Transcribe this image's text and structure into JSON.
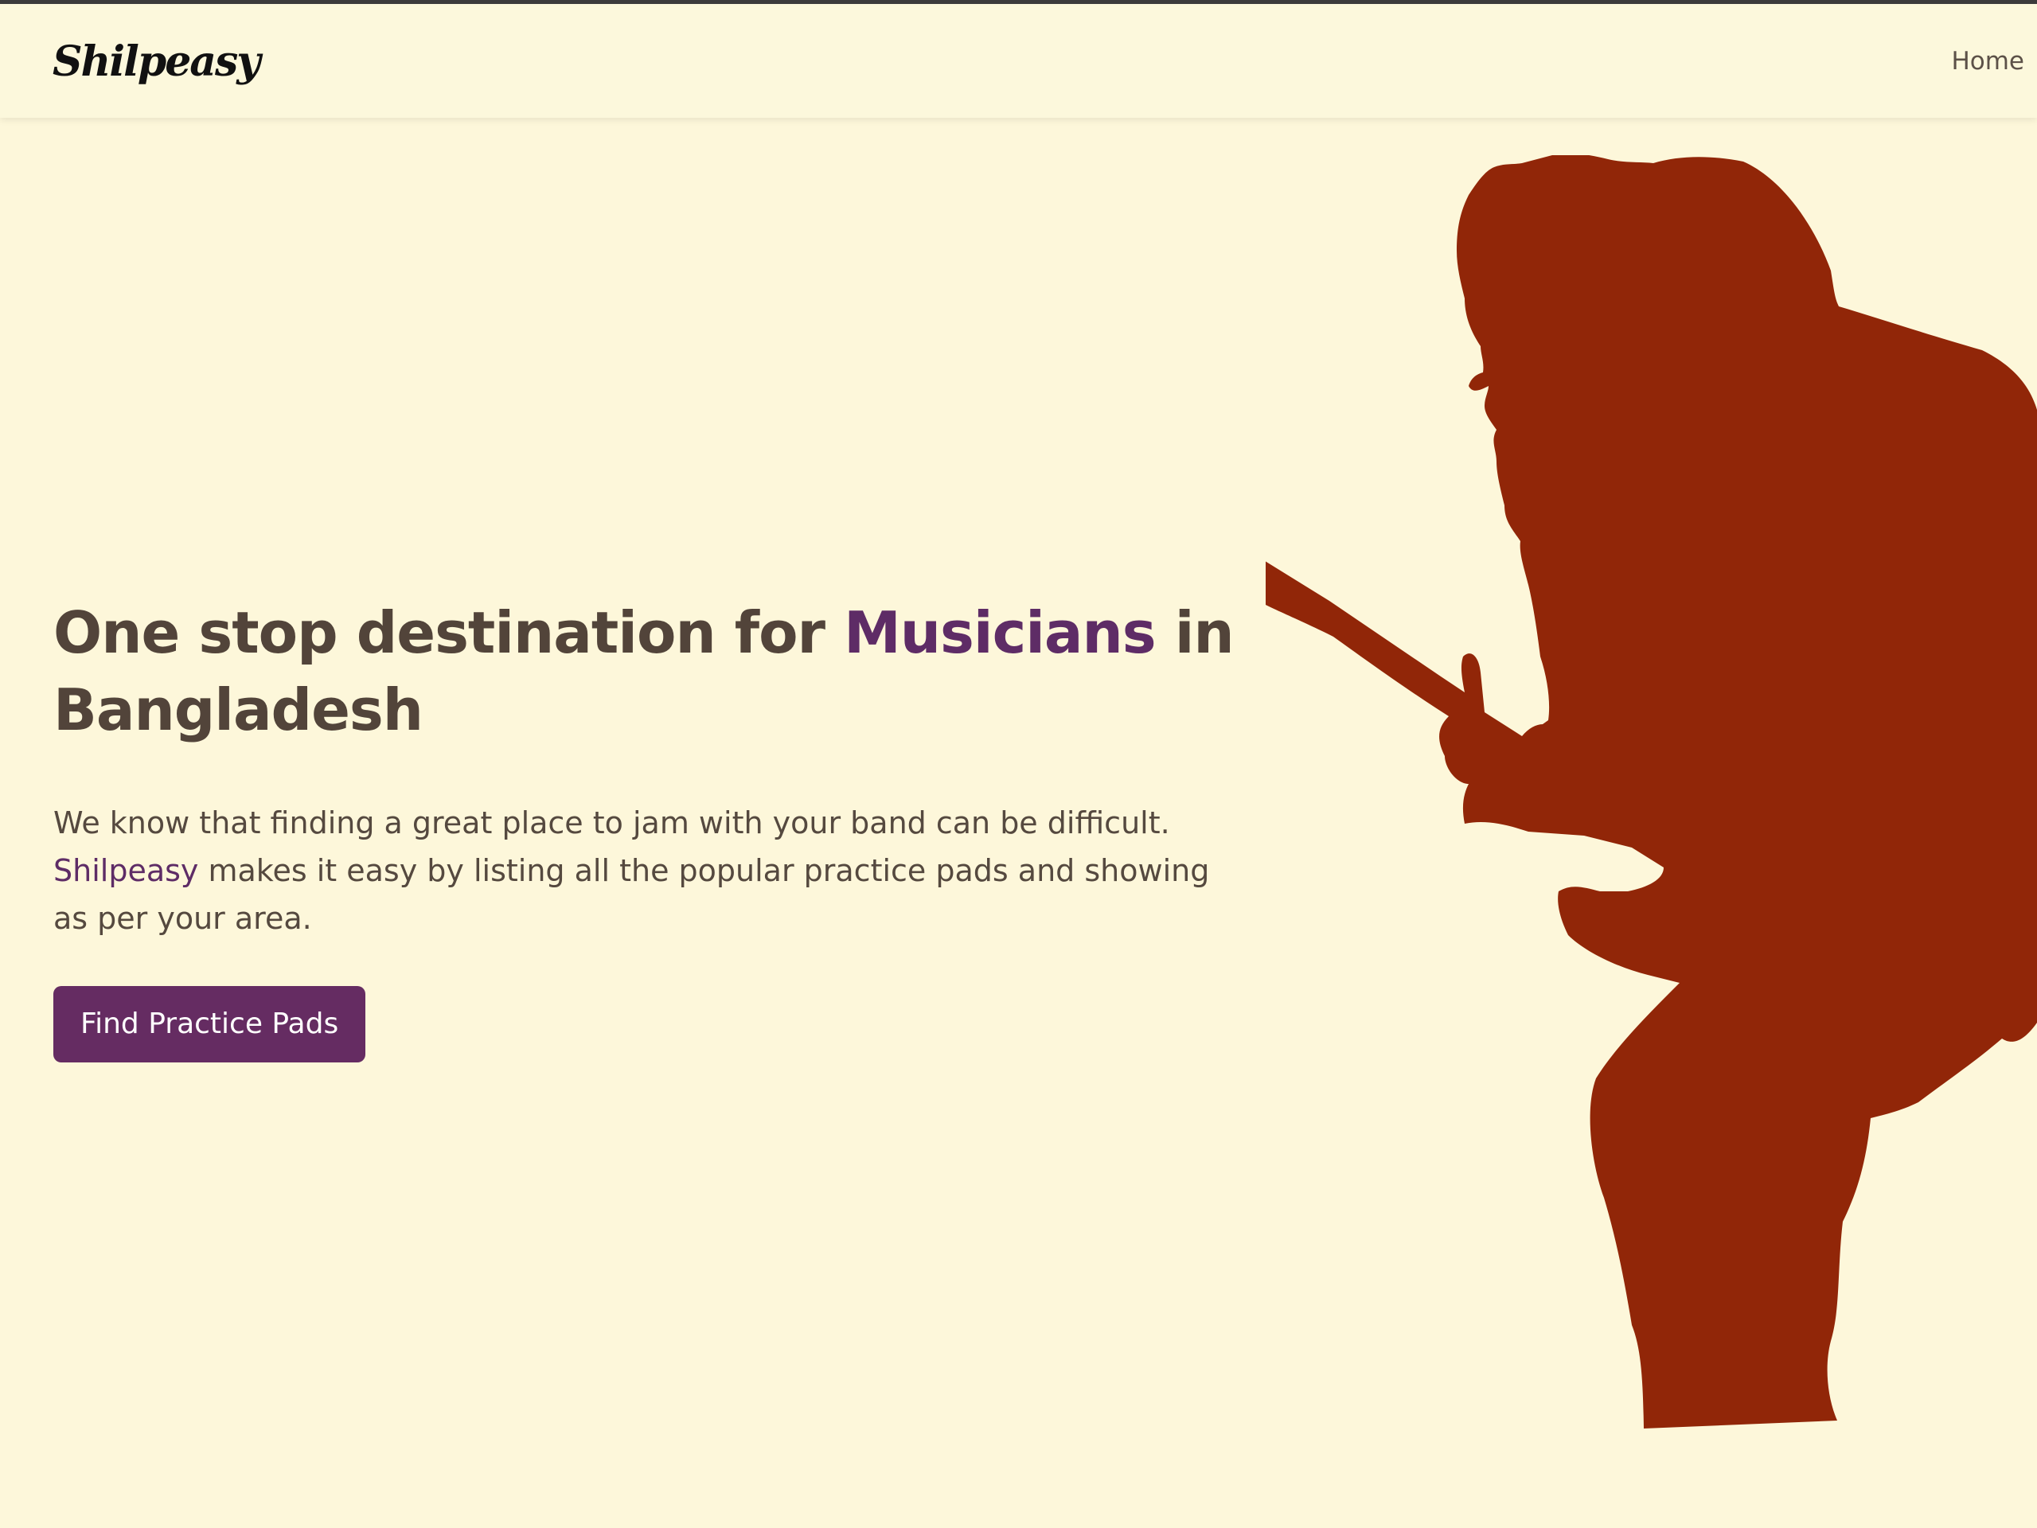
{
  "nav": {
    "brand": "Shilpeasy",
    "links": [
      {
        "label": "Home"
      }
    ]
  },
  "hero": {
    "title_before": "One stop destination for ",
    "title_accent": "Musicians",
    "title_after": " in Bangladesh",
    "description_before": "We know that finding a great place to jam with your band can be difficult. ",
    "description_accent": "Shilpeasy",
    "description_after": " makes it easy by listing all the popular practice pads and showing as per your area.",
    "cta_label": "Find Practice Pads",
    "illustration": "guitarist-silhouette"
  },
  "colors": {
    "background": "#FDF7DA",
    "text": "#52443A",
    "accent": "#5E2C66",
    "button": "#652C62",
    "silhouette": "#912608"
  }
}
